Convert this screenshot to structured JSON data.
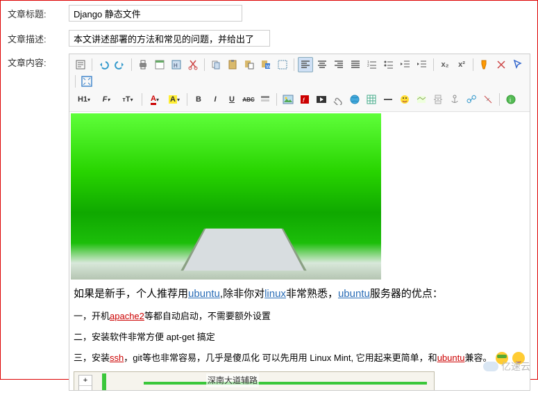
{
  "form": {
    "title_label": "文章标题:",
    "title_value": "Django 静态文件",
    "desc_label": "文章描述:",
    "desc_value": "本文讲述部署的方法和常见的问题，并给出了",
    "content_label": "文章内容:"
  },
  "toolbar": {
    "source": "源",
    "heading_select": "H1",
    "font_select": "F",
    "size_select": "T",
    "fontcolor": "A",
    "bgcolor": "A",
    "bold": "B",
    "italic": "I",
    "underline": "U",
    "strike": "ABC"
  },
  "content": {
    "p1_a": "如果是新手，个人推荐用",
    "p1_link1": "ubuntu",
    "p1_b": ",除非你对",
    "p1_link2": "linux",
    "p1_c": "非常熟悉，",
    "p1_link3": "ubuntu",
    "p1_d": "服务器的优点：",
    "p2_a": "一，开机",
    "p2_link1": "apache2",
    "p2_b": "等都自动启动，不需要额外设置",
    "p3": "二，安装软件非常方便 apt-get 搞定",
    "p4_a": "三，安装",
    "p4_link1": "ssh",
    "p4_b": "，git等也非常容易，几乎是傻瓜化 可以先用用 Linux Mint, 它用起来更简单，和",
    "p4_link2": "ubuntu",
    "p4_c": "兼容。"
  },
  "map": {
    "road_label": "深南大道辅路",
    "zoom_in": "+",
    "zoom_out": "−"
  },
  "watermark": "亿速云"
}
